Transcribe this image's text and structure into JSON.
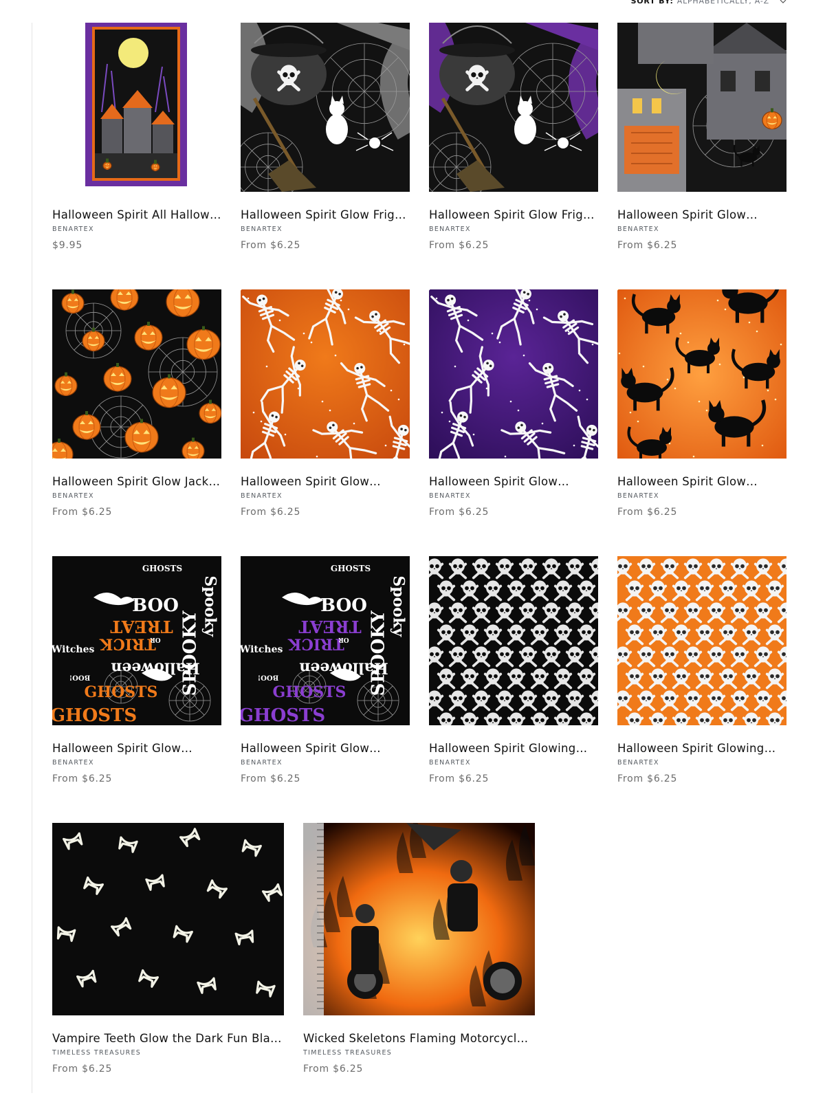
{
  "sort": {
    "label": "SORT BY:",
    "value": "ALPHABETICALLY, A-Z"
  },
  "products": [
    {
      "title": "Halloween Spirit All Hallow'…",
      "vendor": "BENARTEX",
      "price": "$9.95",
      "pattern": "panel-haunted-village"
    },
    {
      "title": "Halloween Spirit Glow Frigh…",
      "vendor": "BENARTEX",
      "price": "From $6.25",
      "pattern": "cauldron-gray"
    },
    {
      "title": "Halloween Spirit Glow Frigh…",
      "vendor": "BENARTEX",
      "price": "From $6.25",
      "pattern": "cauldron-purple"
    },
    {
      "title": "Halloween Spirit Glow…",
      "vendor": "BENARTEX",
      "price": "From $6.25",
      "pattern": "haunted-houses"
    },
    {
      "title": "Halloween Spirit Glow Jack-…",
      "vendor": "BENARTEX",
      "price": "From $6.25",
      "pattern": "jack-o-lanterns"
    },
    {
      "title": "Halloween Spirit Glow…",
      "vendor": "BENARTEX",
      "price": "From $6.25",
      "pattern": "skeletons-orange"
    },
    {
      "title": "Halloween Spirit Glow…",
      "vendor": "BENARTEX",
      "price": "From $6.25",
      "pattern": "skeletons-purple"
    },
    {
      "title": "Halloween Spirit Glow…",
      "vendor": "BENARTEX",
      "price": "From $6.25",
      "pattern": "black-cats-orange"
    },
    {
      "title": "Halloween Spirit Glow…",
      "vendor": "BENARTEX",
      "price": "From $6.25",
      "pattern": "words-orange"
    },
    {
      "title": "Halloween Spirit Glow…",
      "vendor": "BENARTEX",
      "price": "From $6.25",
      "pattern": "words-purple"
    },
    {
      "title": "Halloween Spirit Glowing…",
      "vendor": "BENARTEX",
      "price": "From $6.25",
      "pattern": "skulls-black"
    },
    {
      "title": "Halloween Spirit Glowing…",
      "vendor": "BENARTEX",
      "price": "From $6.25",
      "pattern": "skulls-orange"
    },
    {
      "title": "Vampire Teeth Glow the Dark Fun Blac…",
      "vendor": "TIMELESS TREASURES",
      "price": "From $6.25",
      "pattern": "vampire-teeth"
    },
    {
      "title": "Wicked Skeletons Flaming Motorcycles…",
      "vendor": "TIMELESS TREASURES",
      "price": "From $6.25",
      "pattern": "flaming-motorcycles"
    }
  ],
  "fabric_words": [
    "BOO",
    "TREAT",
    "TRICK",
    "OR",
    "GHOSTS",
    "SPOOKY",
    "Halloween",
    "Witches",
    "Spooky",
    "BOO!"
  ],
  "colors": {
    "orange": "#f07a1a",
    "purple": "#6a2fa0",
    "black": "#0b0b0b",
    "moon": "#f3ea7a"
  }
}
